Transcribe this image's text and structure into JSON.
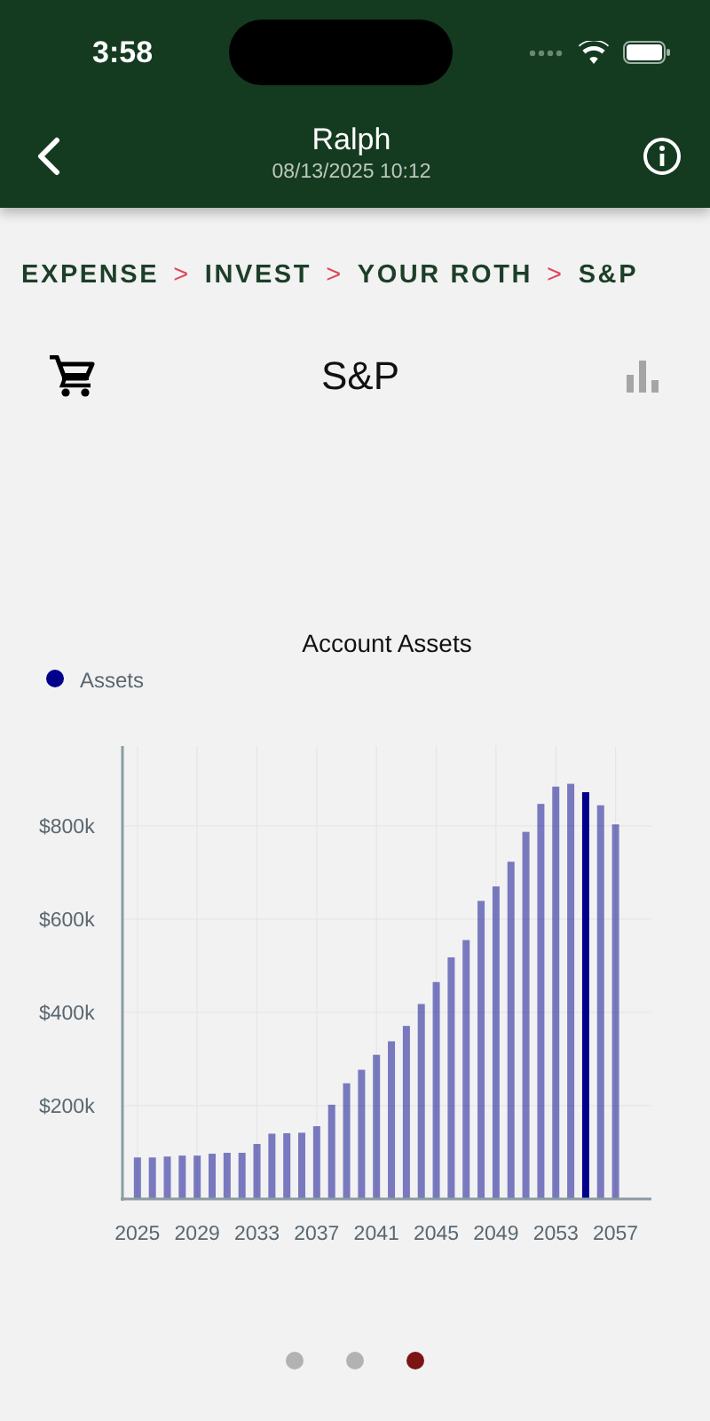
{
  "status_bar": {
    "time": "3:58"
  },
  "nav_bar": {
    "title": "Ralph",
    "subtitle": "08/13/2025 10:12"
  },
  "breadcrumb": [
    {
      "label": "EXPENSE",
      "separator": ">"
    },
    {
      "label": "INVEST",
      "separator": ">"
    },
    {
      "label": "YOUR ROTH",
      "separator": ">"
    },
    {
      "label": "S&P"
    }
  ],
  "header": {
    "title": "S&P"
  },
  "chart": {
    "chart_data": {
      "type": "bar",
      "title": "Account Assets",
      "x": [
        2025,
        2026,
        2027,
        2028,
        2029,
        2030,
        2031,
        2032,
        2033,
        2034,
        2035,
        2036,
        2037,
        2038,
        2039,
        2040,
        2041,
        2042,
        2043,
        2044,
        2045,
        2046,
        2047,
        2048,
        2049,
        2050,
        2051,
        2052,
        2053,
        2054,
        2055,
        2056,
        2057
      ],
      "series": [
        {
          "name": "Assets",
          "color": "#00008b",
          "values": [
            89,
            89,
            91,
            93,
            93,
            97,
            99,
            99,
            118,
            140,
            141,
            142,
            156,
            202,
            248,
            277,
            309,
            338,
            371,
            418,
            465,
            518,
            555,
            639,
            670,
            723,
            787,
            847,
            884,
            890,
            872,
            844,
            803
          ]
        }
      ],
      "xlim": [
        2024,
        2059.4
      ],
      "ylim": [
        0,
        971
      ],
      "xticks": [
        2025,
        2029,
        2033,
        2037,
        2041,
        2045,
        2049,
        2053,
        2057
      ],
      "yticks": [
        {
          "value": 200,
          "label": "$200k"
        },
        {
          "value": 400,
          "label": "$400k"
        },
        {
          "value": 600,
          "label": "$600k"
        },
        {
          "value": 800,
          "label": "$800k"
        }
      ],
      "grid": true
    },
    "bars": [
      {
        "selected": false
      },
      {
        "selected": false
      },
      {
        "selected": false
      },
      {
        "selected": false
      },
      {
        "selected": false
      },
      {
        "selected": false
      },
      {
        "selected": false
      },
      {
        "selected": false
      },
      {
        "selected": false
      },
      {
        "selected": false
      },
      {
        "selected": false
      },
      {
        "selected": false
      },
      {
        "selected": false
      },
      {
        "selected": false
      },
      {
        "selected": false
      },
      {
        "selected": false
      },
      {
        "selected": false
      },
      {
        "selected": false
      },
      {
        "selected": false
      },
      {
        "selected": false
      },
      {
        "selected": false
      },
      {
        "selected": false
      },
      {
        "selected": false
      },
      {
        "selected": false
      },
      {
        "selected": false
      },
      {
        "selected": false
      },
      {
        "selected": false
      },
      {
        "selected": false
      },
      {
        "selected": false
      },
      {
        "selected": false
      },
      {
        "selected": true
      },
      {
        "selected": false
      },
      {
        "selected": false
      }
    ]
  },
  "pager": [
    {
      "selected": false
    },
    {
      "selected": false
    },
    {
      "selected": true
    }
  ]
}
